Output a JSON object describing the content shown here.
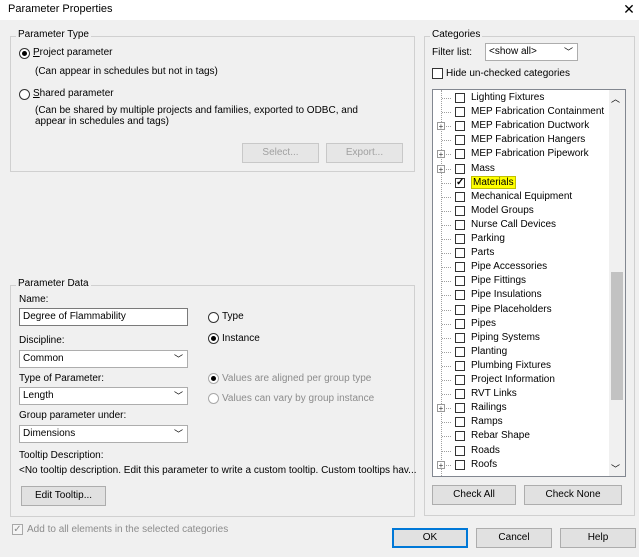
{
  "window": {
    "title": "Parameter Properties",
    "close_glyph": "✕"
  },
  "parameter_type": {
    "group_label": "Parameter Type",
    "project_label": "Project parameter",
    "project_desc": "(Can appear in schedules but not in tags)",
    "shared_label": "Shared parameter",
    "shared_desc_1": "(Can be shared by multiple projects and families, exported to ODBC, and",
    "shared_desc_2": "appear in schedules and tags)",
    "select_button": "Select...",
    "export_button": "Export...",
    "selected": "project"
  },
  "parameter_data": {
    "group_label": "Parameter Data",
    "name_label": "Name:",
    "name_value": "Degree of Flammability",
    "type_label": "Type",
    "instance_label": "Instance",
    "discipline_label": "Discipline:",
    "discipline_value": "Common",
    "type_of_parameter_label": "Type of Parameter:",
    "type_of_parameter_value": "Length",
    "group_under_label": "Group parameter under:",
    "group_under_value": "Dimensions",
    "aligned_label": "Values are aligned per group type",
    "vary_label": "Values can vary by group instance",
    "tooltip_label": "Tooltip Description:",
    "tooltip_text": "<No tooltip description. Edit this parameter to write a custom tooltip. Custom tooltips hav...",
    "edit_tooltip_button": "Edit Tooltip...",
    "selected": "instance"
  },
  "add_to_all": {
    "label": "Add to all elements in the selected categories",
    "checked": true
  },
  "categories": {
    "group_label": "Categories",
    "filter_label": "Filter list:",
    "filter_value": "<show all>",
    "hide_unchecked_label": "Hide un-checked categories",
    "items": [
      {
        "label": "Lighting Fixtures",
        "checked": false,
        "expandable": false
      },
      {
        "label": "MEP Fabrication Containment",
        "checked": false,
        "expandable": false
      },
      {
        "label": "MEP Fabrication Ductwork",
        "checked": false,
        "expandable": true
      },
      {
        "label": "MEP Fabrication Hangers",
        "checked": false,
        "expandable": false
      },
      {
        "label": "MEP Fabrication Pipework",
        "checked": false,
        "expandable": true
      },
      {
        "label": "Mass",
        "checked": false,
        "expandable": true
      },
      {
        "label": "Materials",
        "checked": true,
        "expandable": false,
        "highlighted": true
      },
      {
        "label": "Mechanical Equipment",
        "checked": false,
        "expandable": false
      },
      {
        "label": "Model Groups",
        "checked": false,
        "expandable": false
      },
      {
        "label": "Nurse Call Devices",
        "checked": false,
        "expandable": false
      },
      {
        "label": "Parking",
        "checked": false,
        "expandable": false
      },
      {
        "label": "Parts",
        "checked": false,
        "expandable": false
      },
      {
        "label": "Pipe Accessories",
        "checked": false,
        "expandable": false
      },
      {
        "label": "Pipe Fittings",
        "checked": false,
        "expandable": false
      },
      {
        "label": "Pipe Insulations",
        "checked": false,
        "expandable": false
      },
      {
        "label": "Pipe Placeholders",
        "checked": false,
        "expandable": false
      },
      {
        "label": "Pipes",
        "checked": false,
        "expandable": false
      },
      {
        "label": "Piping Systems",
        "checked": false,
        "expandable": false
      },
      {
        "label": "Planting",
        "checked": false,
        "expandable": false
      },
      {
        "label": "Plumbing Fixtures",
        "checked": false,
        "expandable": false
      },
      {
        "label": "Project Information",
        "checked": false,
        "expandable": false
      },
      {
        "label": "RVT Links",
        "checked": false,
        "expandable": false
      },
      {
        "label": "Railings",
        "checked": false,
        "expandable": true
      },
      {
        "label": "Ramps",
        "checked": false,
        "expandable": false
      },
      {
        "label": "Rebar Shape",
        "checked": false,
        "expandable": false
      },
      {
        "label": "Roads",
        "checked": false,
        "expandable": false
      },
      {
        "label": "Roofs",
        "checked": false,
        "expandable": true
      }
    ],
    "check_all_button": "Check All",
    "check_none_button": "Check None"
  },
  "footer": {
    "ok_button": "OK",
    "cancel_button": "Cancel",
    "help_button": "Help"
  },
  "colors": {
    "highlight": "#ffff00",
    "default_button_border": "#0078d7"
  }
}
